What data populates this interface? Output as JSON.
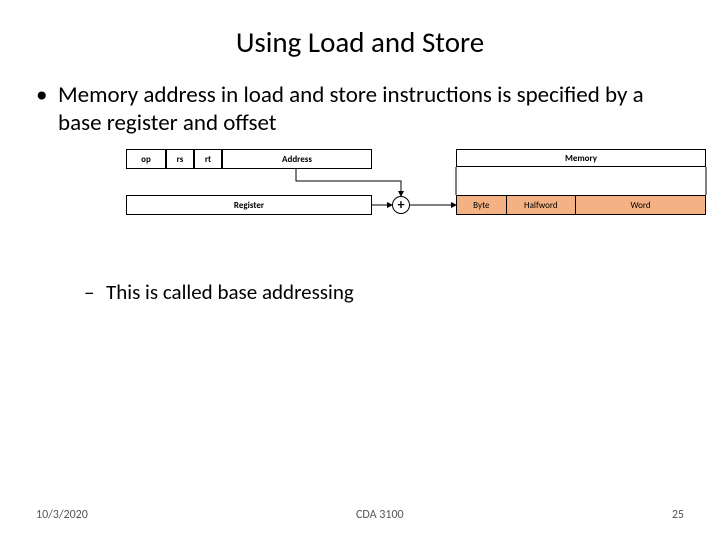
{
  "title": "Using Load and Store",
  "bullet1": "Memory address in load and store instructions is specified by a base register and offset",
  "bullet2": "This is called base addressing",
  "diagram": {
    "op": "op",
    "rs": "rs",
    "rt": "rt",
    "address": "Address",
    "register": "Register",
    "plus": "+",
    "memory": "Memory",
    "byte": "Byte",
    "halfword": "Halfword",
    "word": "Word"
  },
  "footer": {
    "date": "10/3/2020",
    "course": "CDA 3100",
    "page": "25"
  }
}
